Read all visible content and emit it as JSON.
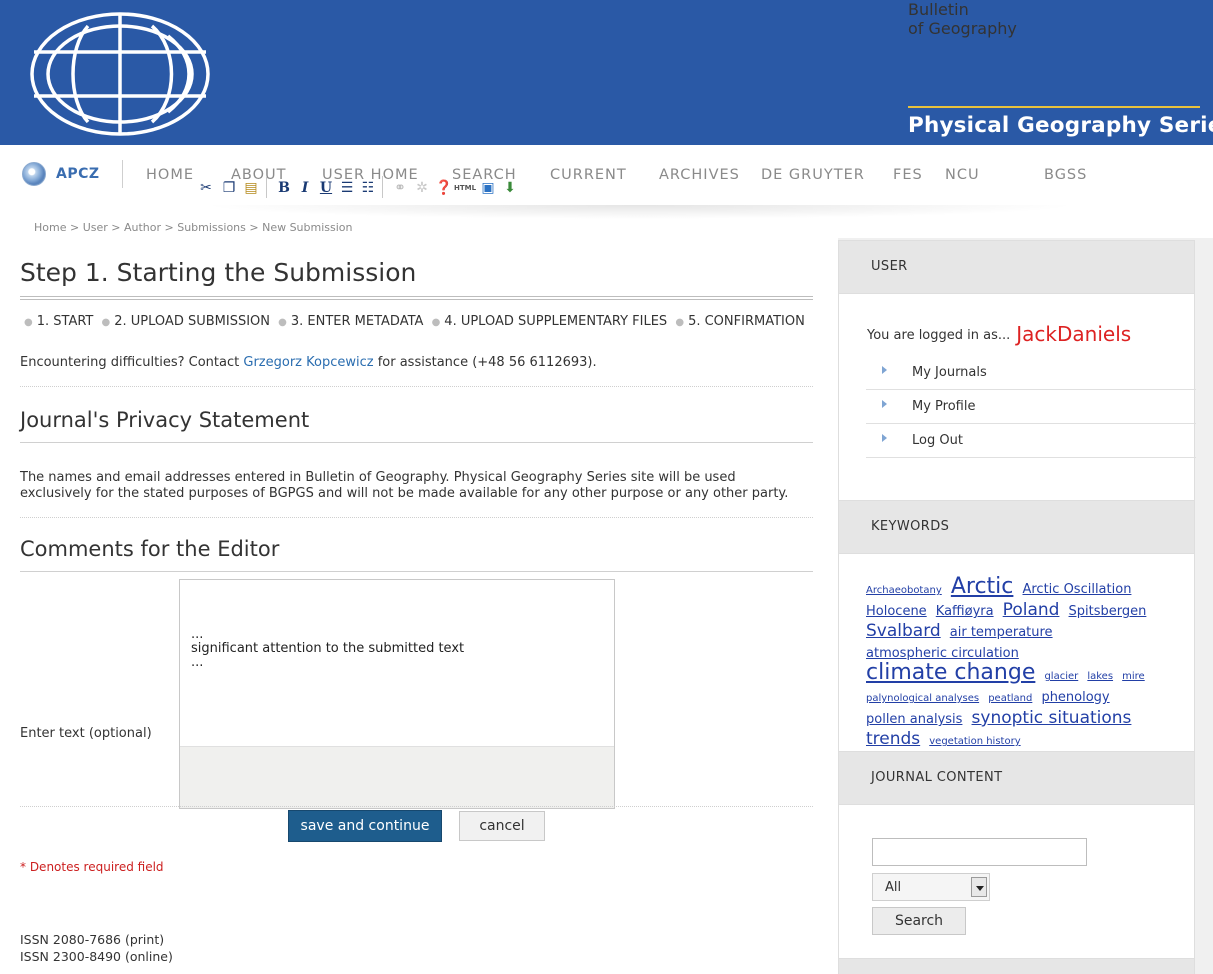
{
  "banner": {
    "title_line1": "Bulletin",
    "title_line2": "of Geography",
    "subtitle": "Physical Geography Series",
    "logo_icon": "journal-globe-logo",
    "bg_color": "#2a59a6",
    "accent_color": "#e9c23b"
  },
  "nav": {
    "brand": "APCZ",
    "items": [
      "HOME",
      "ABOUT",
      "USER HOME",
      "SEARCH",
      "CURRENT",
      "ARCHIVES",
      "DE GRUYTER",
      "FES",
      "NCU",
      "BGSS"
    ]
  },
  "breadcrumb": "Home > User > Author > Submissions > New Submission",
  "main": {
    "title": "Step 1. Starting the Submission",
    "steps": [
      "1. START",
      "2. UPLOAD SUBMISSION",
      "3. ENTER METADATA",
      "4. UPLOAD SUPPLEMENTARY FILES",
      "5. CONFIRMATION"
    ],
    "help_prefix": "Encountering difficulties? Contact ",
    "help_contact": "Grzegorz Kopcewicz",
    "help_suffix": " for assistance (+48 56 6112693).",
    "privacy_heading": "Journal's Privacy Statement",
    "privacy_text": "The names and email addresses entered in Bulletin of Geography. Physical Geography Series site will be used exclusively for the stated purposes of BGPGS and will not be made available for any other purpose or any other party.",
    "comments_heading": "Comments for the Editor",
    "enter_label": "Enter text (optional)",
    "editor_text": "...\nsignificant attention to the submitted text\n...",
    "save_label": "save and continue",
    "cancel_label": "cancel",
    "required_note": "* Denotes required field",
    "issn_print": "ISSN 2080-7686 (print)",
    "issn_online": "ISSN 2300-8490 (online)"
  },
  "sidebar": {
    "user_heading": "USER",
    "logged_prefix": "You are logged in as...",
    "username": "JackDaniels",
    "user_links": [
      "My Journals",
      "My Profile",
      "Log Out"
    ],
    "keywords_heading": "KEYWORDS",
    "keywords": [
      {
        "text": "Archaeobotany",
        "size": 1
      },
      {
        "text": "Arctic",
        "size": 4
      },
      {
        "text": "Arctic Oscillation",
        "size": 2
      },
      {
        "text": "Holocene",
        "size": 2
      },
      {
        "text": "Kaffiøyra",
        "size": 2
      },
      {
        "text": "Poland",
        "size": 3
      },
      {
        "text": "Spitsbergen",
        "size": 2
      },
      {
        "text": "Svalbard",
        "size": 3
      },
      {
        "text": "air temperature",
        "size": 2
      },
      {
        "text": "atmospheric circulation",
        "size": 2
      },
      {
        "text": "climate change",
        "size": 4
      },
      {
        "text": "glacier",
        "size": 1
      },
      {
        "text": "lakes",
        "size": 1
      },
      {
        "text": "mire",
        "size": 1
      },
      {
        "text": "palynological analyses",
        "size": 1
      },
      {
        "text": "peatland",
        "size": 1
      },
      {
        "text": "phenology",
        "size": 2
      },
      {
        "text": "pollen analysis",
        "size": 2
      },
      {
        "text": "synoptic situations",
        "size": 3
      },
      {
        "text": "trends",
        "size": 3
      },
      {
        "text": "vegetation history",
        "size": 1
      }
    ],
    "journal_content_heading": "JOURNAL CONTENT",
    "search_field_value": "",
    "search_scope": "All",
    "search_button": "Search"
  },
  "colors": {
    "link": "#2a6db0",
    "button_primary": "#1e5d8d",
    "username": "#dd2222",
    "required": "#cc1f1f"
  }
}
